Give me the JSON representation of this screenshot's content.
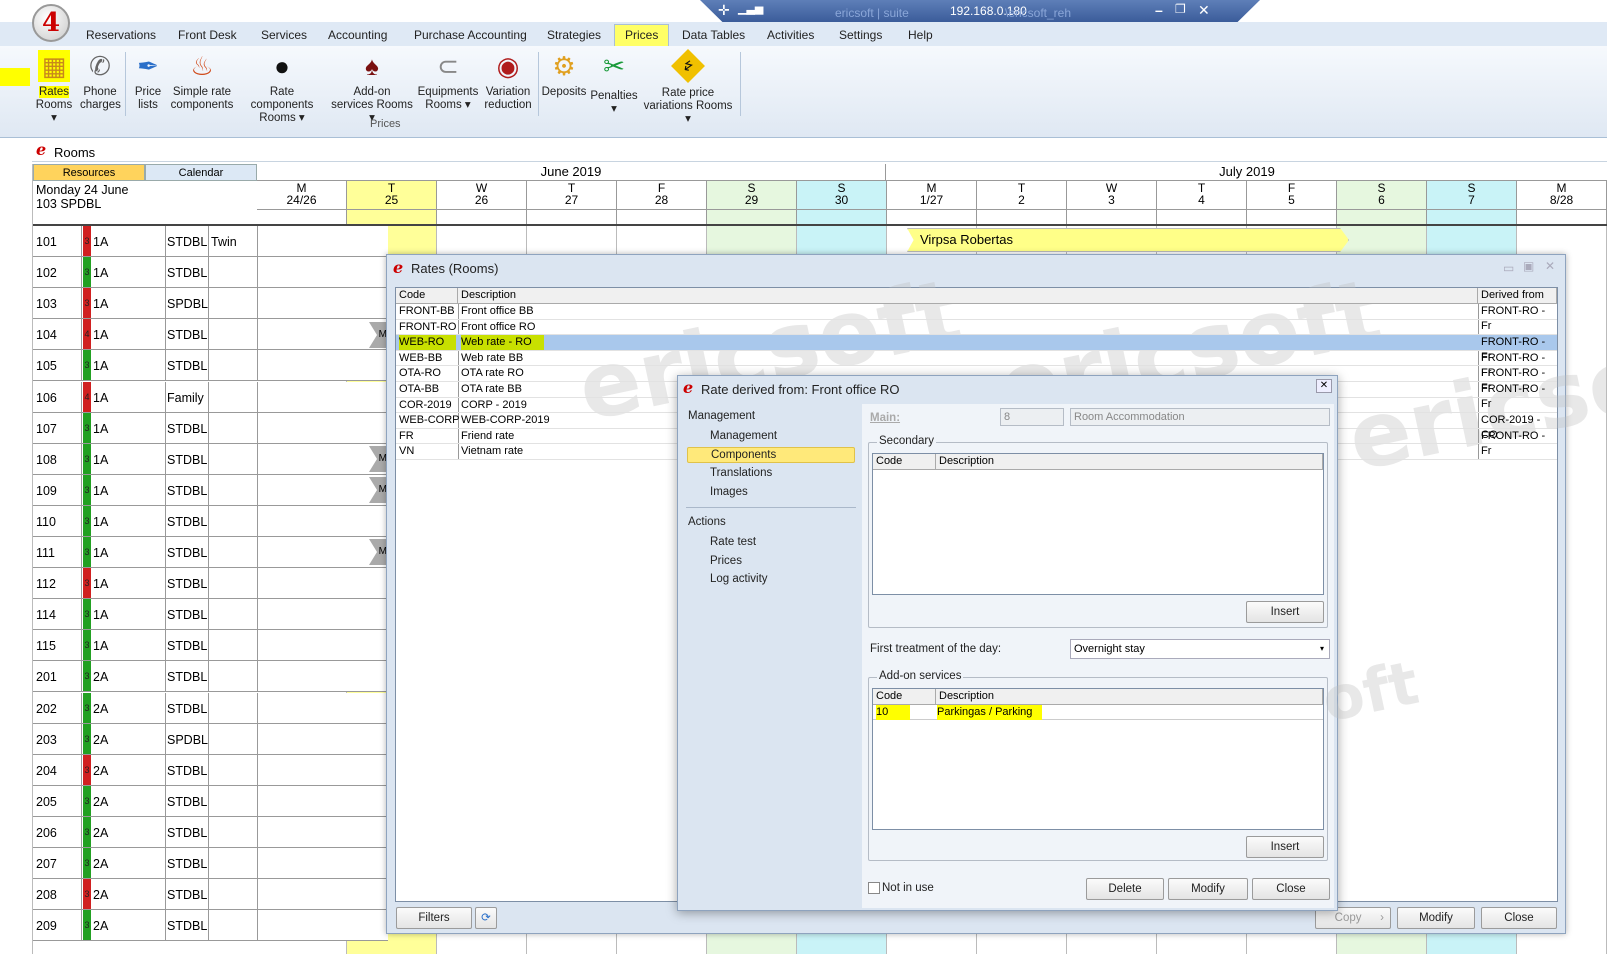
{
  "titlebar": {
    "ip": "192.168.0.180",
    "ghost": "ericsoft | suite",
    "ghost2": "\\ericsoft_reh"
  },
  "app_logo": "4",
  "menu": [
    "Reservations",
    "Front Desk",
    "Services",
    "Accounting",
    "Purchase Accounting",
    "Strategies",
    "Prices",
    "Data Tables",
    "Activities",
    "Settings",
    "Help"
  ],
  "ribbon": {
    "rates": [
      "Rates",
      "Rooms"
    ],
    "phone": [
      "Phone",
      "charges"
    ],
    "price_lists": [
      "Price",
      "lists"
    ],
    "simple_rate": [
      "Simple rate",
      "components"
    ],
    "rate_components": [
      "Rate components",
      "Rooms"
    ],
    "addon": [
      "Add-on",
      "services Rooms"
    ],
    "equipments": [
      "Equipments",
      "Rooms"
    ],
    "variation": [
      "Variation",
      "reduction"
    ],
    "deposits": "Deposits",
    "penalties": "Penalties",
    "rate_price_var": [
      "Rate price",
      "variations Rooms"
    ],
    "group_label": "Prices"
  },
  "rooms_bar": {
    "title": "Rooms"
  },
  "schedule": {
    "tabs": [
      "Resources",
      "Calendar"
    ],
    "current_date": "Monday 24 June",
    "current_room": "103 SPDBL",
    "months": [
      "June 2019",
      "July 2019"
    ],
    "days": [
      {
        "dow": "M",
        "num": "24/26"
      },
      {
        "dow": "T",
        "num": "25"
      },
      {
        "dow": "W",
        "num": "26"
      },
      {
        "dow": "T",
        "num": "27"
      },
      {
        "dow": "F",
        "num": "28"
      },
      {
        "dow": "S",
        "num": "29"
      },
      {
        "dow": "S",
        "num": "30"
      },
      {
        "dow": "M",
        "num": "1/27"
      },
      {
        "dow": "T",
        "num": "2"
      },
      {
        "dow": "W",
        "num": "3"
      },
      {
        "dow": "T",
        "num": "4"
      },
      {
        "dow": "F",
        "num": "5"
      },
      {
        "dow": "S",
        "num": "6"
      },
      {
        "dow": "S",
        "num": "7"
      },
      {
        "dow": "M",
        "num": "8/28"
      }
    ],
    "rooms": [
      {
        "no": "101",
        "status": "3",
        "floor": "1A",
        "type": "STDBL",
        "extra": "Twin",
        "color": "#d02020"
      },
      {
        "no": "102",
        "status": "3",
        "floor": "1A",
        "type": "STDBL",
        "extra": "",
        "color": "#22a022"
      },
      {
        "no": "103",
        "status": "3",
        "floor": "1A",
        "type": "SPDBL",
        "extra": "",
        "color": "#d02020"
      },
      {
        "no": "104",
        "status": "4",
        "floor": "1A",
        "type": "STDBL",
        "extra": "",
        "color": "#d02020"
      },
      {
        "no": "105",
        "status": "3",
        "floor": "1A",
        "type": "STDBL",
        "extra": "",
        "color": "#22a022"
      },
      {
        "no": "106",
        "status": "4",
        "floor": "1A",
        "type": "Family",
        "extra": "",
        "color": "#d02020"
      },
      {
        "no": "107",
        "status": "3",
        "floor": "1A",
        "type": "STDBL",
        "extra": "",
        "color": "#22a022"
      },
      {
        "no": "108",
        "status": "3",
        "floor": "1A",
        "type": "STDBL",
        "extra": "",
        "color": "#22a022"
      },
      {
        "no": "109",
        "status": "3",
        "floor": "1A",
        "type": "STDBL",
        "extra": "",
        "color": "#22a022"
      },
      {
        "no": "110",
        "status": "3",
        "floor": "1A",
        "type": "STDBL",
        "extra": "",
        "color": "#22a022"
      },
      {
        "no": "111",
        "status": "3",
        "floor": "1A",
        "type": "STDBL",
        "extra": "",
        "color": "#22a022"
      },
      {
        "no": "112",
        "status": "3",
        "floor": "1A",
        "type": "STDBL",
        "extra": "",
        "color": "#d02020"
      },
      {
        "no": "114",
        "status": "3",
        "floor": "1A",
        "type": "STDBL",
        "extra": "",
        "color": "#22a022"
      },
      {
        "no": "115",
        "status": "3",
        "floor": "1A",
        "type": "STDBL",
        "extra": "",
        "color": "#22a022"
      },
      {
        "no": "201",
        "status": "3",
        "floor": "2A",
        "type": "STDBL",
        "extra": "",
        "color": "#22a022"
      },
      {
        "no": "202",
        "status": "3",
        "floor": "2A",
        "type": "STDBL",
        "extra": "",
        "color": "#22a022"
      },
      {
        "no": "203",
        "status": "3",
        "floor": "2A",
        "type": "SPDBL",
        "extra": "",
        "color": "#22a022"
      },
      {
        "no": "204",
        "status": "3",
        "floor": "2A",
        "type": "STDBL",
        "extra": "",
        "color": "#d02020"
      },
      {
        "no": "205",
        "status": "3",
        "floor": "2A",
        "type": "STDBL",
        "extra": "",
        "color": "#22a022"
      },
      {
        "no": "206",
        "status": "3",
        "floor": "2A",
        "type": "STDBL",
        "extra": "",
        "color": "#22a022"
      },
      {
        "no": "207",
        "status": "3",
        "floor": "2A",
        "type": "STDBL",
        "extra": "",
        "color": "#22a022"
      },
      {
        "no": "208",
        "status": "3",
        "floor": "2A",
        "type": "STDBL",
        "extra": "",
        "color": "#d02020"
      },
      {
        "no": "209",
        "status": "3",
        "floor": "2A",
        "type": "STDBL",
        "extra": "",
        "color": "#22a022"
      }
    ],
    "booking": "Virpsa Robertas",
    "booking_tags": [
      "M",
      "M",
      "M",
      "M"
    ]
  },
  "rates_dialog": {
    "title": "Rates (Rooms)",
    "columns": [
      "Code",
      "Description",
      "Derived from"
    ],
    "rows": [
      {
        "code": "FRONT-BB",
        "desc": "Front office BB",
        "derived": "FRONT-RO - Fr"
      },
      {
        "code": "FRONT-RO",
        "desc": "Front office RO",
        "derived": ""
      },
      {
        "code": "WEB-RO",
        "desc": "Web rate - RO",
        "derived": "FRONT-RO - Fr"
      },
      {
        "code": "WEB-BB",
        "desc": "Web rate BB",
        "derived": "FRONT-RO - Fr"
      },
      {
        "code": "OTA-RO",
        "desc": "OTA rate RO",
        "derived": "FRONT-RO - Fr"
      },
      {
        "code": "OTA-BB",
        "desc": "OTA rate BB",
        "derived": "FRONT-RO - Fr"
      },
      {
        "code": "COR-2019",
        "desc": "CORP - 2019",
        "derived": ""
      },
      {
        "code": "WEB-CORP",
        "desc": "WEB-CORP-2019",
        "derived": "COR-2019 - CO"
      },
      {
        "code": "FR",
        "desc": "Friend rate",
        "derived": "FRONT-RO - Fr"
      },
      {
        "code": "VN",
        "desc": "Vietnam rate",
        "derived": ""
      }
    ],
    "selected_index": 2,
    "buttons": {
      "filters": "Filters",
      "copy": "Copy",
      "modify": "Modify",
      "close": "Close"
    }
  },
  "derived_dialog": {
    "title": "Rate derived from: Front office RO",
    "nav": {
      "management_header": "Management",
      "management_items": [
        "Management",
        "Components",
        "Translations",
        "Images"
      ],
      "actions_header": "Actions",
      "action_items": [
        "Rate test",
        "Prices",
        "Log activity"
      ]
    },
    "main_label": "Main:",
    "main_code": "8",
    "main_desc": "Room Accommodation",
    "secondary_label": "Secondary",
    "grid_columns": [
      "Code",
      "Description"
    ],
    "insert_label": "Insert",
    "first_treatment_label": "First treatment of the day:",
    "first_treatment_value": "Overnight stay",
    "addon_label": "Add-on services",
    "addon_rows": [
      {
        "code": "10",
        "desc": "Parkingas / Parking"
      }
    ],
    "not_in_use": "Not in use",
    "buttons": {
      "delete": "Delete",
      "modify": "Modify",
      "close": "Close"
    }
  },
  "watermark": "ericsoft"
}
